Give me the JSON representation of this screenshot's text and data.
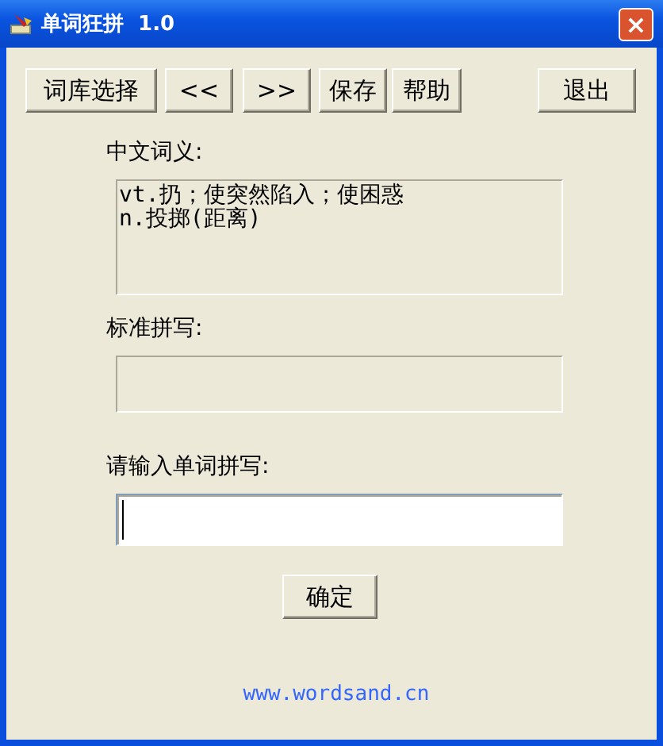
{
  "window": {
    "title": "单词狂拼  1.0",
    "close": "×"
  },
  "toolbar": [
    {
      "label": "词库选择",
      "kind": "left"
    },
    {
      "label": "<<",
      "kind": "left"
    },
    {
      "label": ">>",
      "kind": "left"
    },
    {
      "label": "保存",
      "kind": "left"
    },
    {
      "label": "帮助",
      "kind": "left"
    },
    {
      "label": "退出",
      "kind": "right"
    }
  ],
  "meaning": {
    "label": "中文词义:",
    "lines": [
      "vt.扔；使突然陷入；使困惑",
      "n.投掷(距离)"
    ]
  },
  "standard": {
    "label": "标准拼写:"
  },
  "input": {
    "label": "请输入单词拼写:"
  },
  "confirm": "确定",
  "link": "www.wordsand.cn"
}
